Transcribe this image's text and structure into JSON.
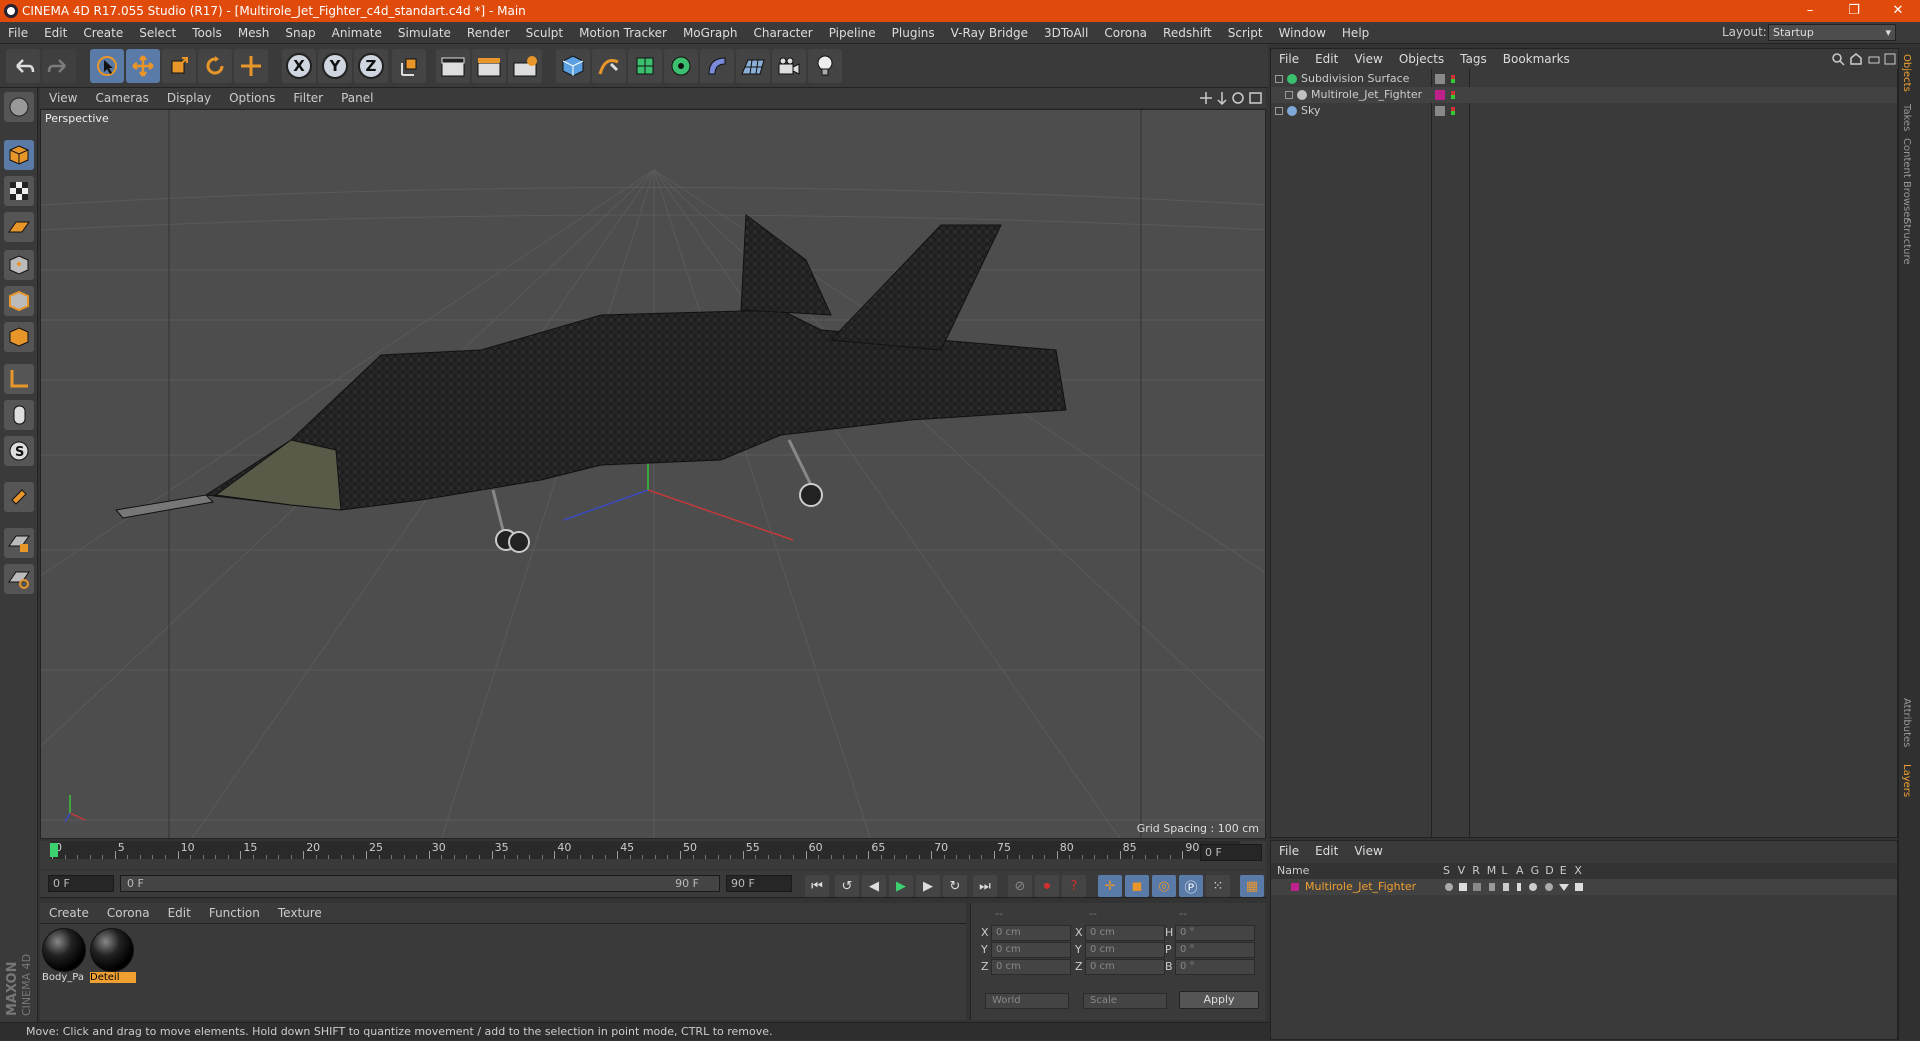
{
  "window": {
    "title": "CINEMA 4D R17.055 Studio (R17) - [Multirole_Jet_Fighter_c4d_standart.c4d *] - Main",
    "controls": [
      "–",
      "❐",
      "✕"
    ]
  },
  "menubar": [
    "File",
    "Edit",
    "Create",
    "Select",
    "Tools",
    "Mesh",
    "Snap",
    "Animate",
    "Simulate",
    "Render",
    "Sculpt",
    "Motion Tracker",
    "MoGraph",
    "Character",
    "Pipeline",
    "Plugins",
    "V-Ray Bridge",
    "3DToAll",
    "Corona",
    "Redshift",
    "Script",
    "Window",
    "Help"
  ],
  "layout": {
    "label": "Layout:",
    "value": "Startup"
  },
  "toolbar": {
    "axis_x": "X",
    "axis_y": "Y",
    "axis_z": "Z"
  },
  "viewport": {
    "menu": [
      "View",
      "Cameras",
      "Display",
      "Options",
      "Filter",
      "Panel"
    ],
    "label": "Perspective",
    "grid_spacing": "Grid Spacing : 100 cm"
  },
  "timeline": {
    "ticks": [
      "0",
      "5",
      "10",
      "15",
      "20",
      "25",
      "30",
      "35",
      "40",
      "45",
      "50",
      "55",
      "60",
      "65",
      "70",
      "75",
      "80",
      "85",
      "90"
    ],
    "current_frame": "0 F",
    "start_field": "0 F",
    "range_start": "0 F",
    "range_end": "90 F",
    "end_field": "90 F"
  },
  "materials": {
    "menu": [
      "Create",
      "Corona",
      "Edit",
      "Function",
      "Texture"
    ],
    "items": [
      {
        "name": "Body_Pa",
        "selected": false
      },
      {
        "name": "Deteil",
        "selected": true
      }
    ]
  },
  "coords": {
    "headers": [
      "--",
      "--",
      "--"
    ],
    "rows": [
      {
        "l1": "X",
        "v1": "0 cm",
        "l2": "X",
        "v2": "0 cm",
        "l3": "H",
        "v3": "0 °"
      },
      {
        "l1": "Y",
        "v1": "0 cm",
        "l2": "Y",
        "v2": "0 cm",
        "l3": "P",
        "v3": "0 °"
      },
      {
        "l1": "Z",
        "v1": "0 cm",
        "l2": "Z",
        "v2": "0 cm",
        "l3": "B",
        "v3": "0 °"
      }
    ],
    "mode1": "World",
    "mode2": "Scale",
    "apply": "Apply"
  },
  "objects": {
    "menu": [
      "File",
      "Edit",
      "View",
      "Objects",
      "Tags",
      "Bookmarks"
    ],
    "items": [
      {
        "name": "Subdivision Surface",
        "indent": 0,
        "icon_color": "#3cc070"
      },
      {
        "name": "Multirole_Jet_Fighter",
        "indent": 1,
        "icon_color": "#c0c0c0"
      },
      {
        "name": "Sky",
        "indent": 0,
        "icon_color": "#7fa8d8"
      }
    ]
  },
  "layers": {
    "menu": [
      "File",
      "Edit",
      "View"
    ],
    "columns": {
      "name": "Name",
      "flags": [
        "S",
        "V",
        "R",
        "M",
        "L",
        "A",
        "G",
        "D",
        "E",
        "X"
      ]
    },
    "rows": [
      {
        "name": "Multirole_Jet_Fighter",
        "color": "#c0208a"
      }
    ]
  },
  "right_tabs": [
    "Objects",
    "Takes",
    "Content Browser",
    "Structure",
    "Attributes",
    "Layers"
  ],
  "status": "Move: Click and drag to move elements. Hold down SHIFT to quantize movement / add to the selection in point mode, CTRL to remove.",
  "branding": {
    "line1": "MAXON",
    "line2": "CINEMA 4D"
  },
  "colors": {
    "titlebar": "#e04a0b",
    "active_tool": "#5a7aa8",
    "accent": "#f0a030"
  }
}
